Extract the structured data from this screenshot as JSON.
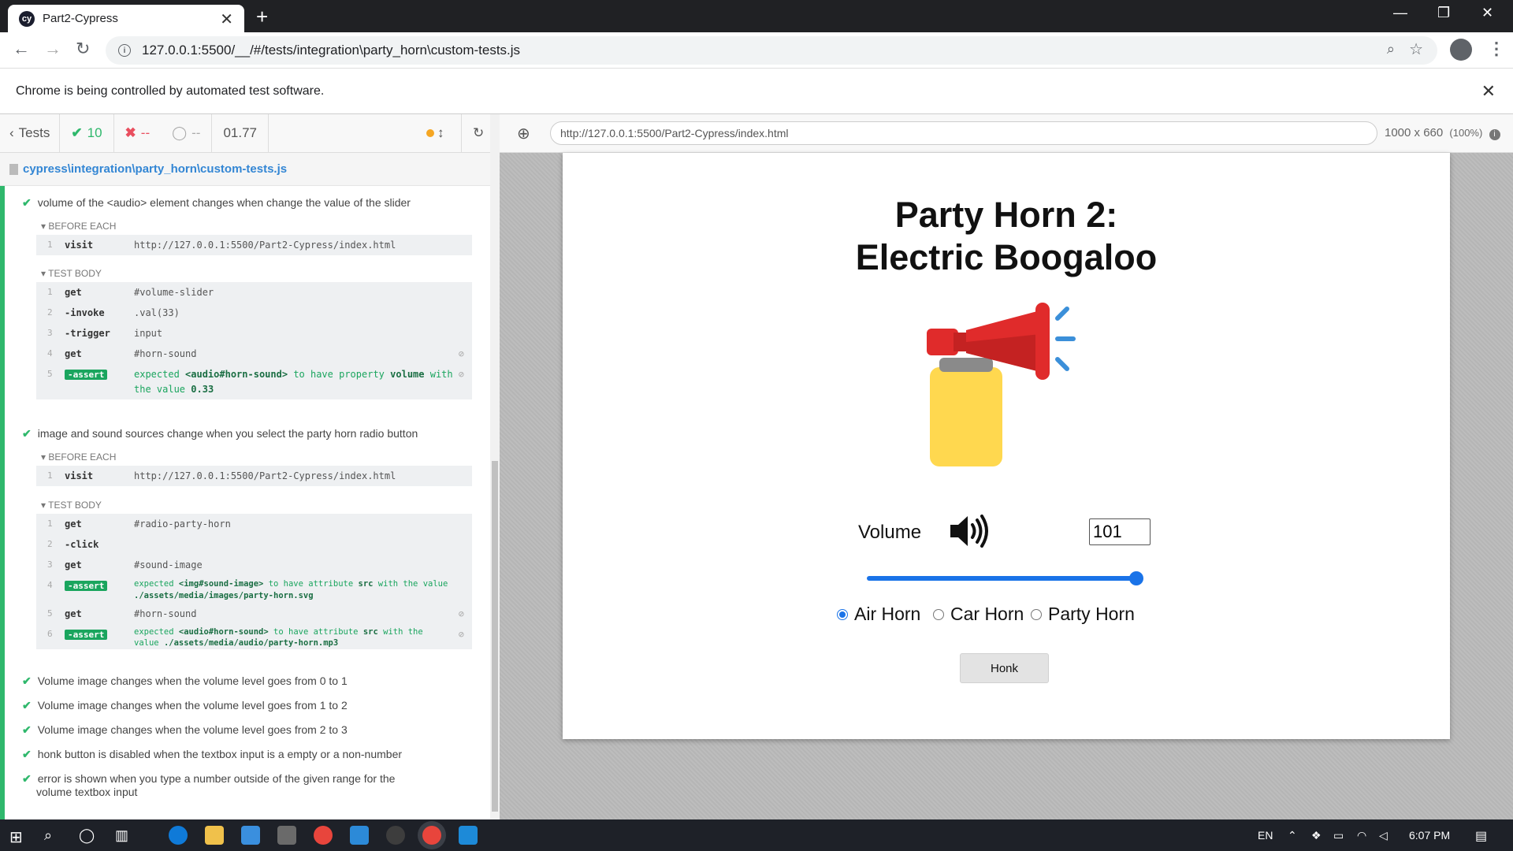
{
  "browser": {
    "tab_title": "Part2-Cypress",
    "tab_favicon": "cy",
    "url": "127.0.0.1:5500/__/#/tests/integration\\party_horn\\custom-tests.js",
    "infobar_text": "Chrome is being controlled by automated test software."
  },
  "reporter": {
    "back_label": "Tests",
    "passed": "10",
    "failed": "--",
    "pending": "--",
    "duration": "01.77",
    "spec_path": "cypress\\integration\\party_horn\\custom-tests.js",
    "tests": [
      {
        "title": "volume of the <audio> element changes when change the value of the slider",
        "before_each_label": "BEFORE EACH",
        "before_each": [
          {
            "num": "1",
            "name": "visit",
            "msg": "http://127.0.0.1:5500/Part2-Cypress/index.html"
          }
        ],
        "test_body_label": "TEST BODY",
        "commands": [
          {
            "num": "1",
            "name": "get",
            "msg": "#volume-slider"
          },
          {
            "num": "2",
            "name": "-invoke",
            "msg": ".val(33)"
          },
          {
            "num": "3",
            "name": "-trigger",
            "msg": "input"
          },
          {
            "num": "4",
            "name": "get",
            "msg": "#horn-sound"
          },
          {
            "num": "5",
            "name": "-assert",
            "msg_a": "expected",
            "msg_b": "<audio#horn-sound>",
            "msg_c": "to have property",
            "msg_d": "volume",
            "msg_e": "with the value",
            "msg_f": "0.33"
          }
        ]
      },
      {
        "title": "image and sound sources change when you select the party horn radio button",
        "before_each_label": "BEFORE EACH",
        "before_each": [
          {
            "num": "1",
            "name": "visit",
            "msg": "http://127.0.0.1:5500/Part2-Cypress/index.html"
          }
        ],
        "test_body_label": "TEST BODY",
        "commands": [
          {
            "num": "1",
            "name": "get",
            "msg": "#radio-party-horn"
          },
          {
            "num": "2",
            "name": "-click",
            "msg": ""
          },
          {
            "num": "3",
            "name": "get",
            "msg": "#sound-image"
          },
          {
            "num": "4",
            "name": "-assert",
            "msg_a": "expected",
            "msg_b": "<img#sound-image>",
            "msg_c": "to have attribute",
            "msg_d": "src",
            "msg_e": "with the value",
            "msg_f": "./assets/media/images/party-horn.svg"
          },
          {
            "num": "5",
            "name": "get",
            "msg": "#horn-sound"
          },
          {
            "num": "6",
            "name": "-assert",
            "msg_a": "expected",
            "msg_b": "<audio#horn-sound>",
            "msg_c": "to have attribute",
            "msg_d": "src",
            "msg_e": "with the",
            "msg_e2": "value",
            "msg_f": "./assets/media/audio/party-horn.mp3"
          }
        ]
      }
    ],
    "passed_tests": [
      "Volume image changes when the volume level goes from 0 to 1",
      "Volume image changes when the volume level goes from 1 to 2",
      "Volume image changes when the volume level goes from 2 to 3",
      "honk button is disabled when the textbox input is a empty or a non-number",
      "error is shown when you type a number outside of the given range for the",
      "volume textbox input"
    ]
  },
  "aut": {
    "url": "http://127.0.0.1:5500/Part2-Cypress/index.html",
    "size": "1000 x 660",
    "scale": "(100%)"
  },
  "app": {
    "title_line1": "Party Horn 2:",
    "title_line2": "Electric Boogaloo",
    "volume_label": "Volume",
    "volume_value": "101",
    "slider_fraction": 1.0,
    "radios": [
      {
        "label": "Air Horn",
        "checked": true
      },
      {
        "label": "Car Horn",
        "checked": false
      },
      {
        "label": "Party Horn",
        "checked": false
      }
    ],
    "honk_label": "Honk"
  },
  "taskbar": {
    "lang": "EN",
    "time": "6:07 PM"
  },
  "colors": {
    "pass_green": "#2fb86c",
    "accent_blue": "#1a73e8",
    "horn_red": "#e02b2b",
    "bottle_yellow": "#ffd84f"
  }
}
